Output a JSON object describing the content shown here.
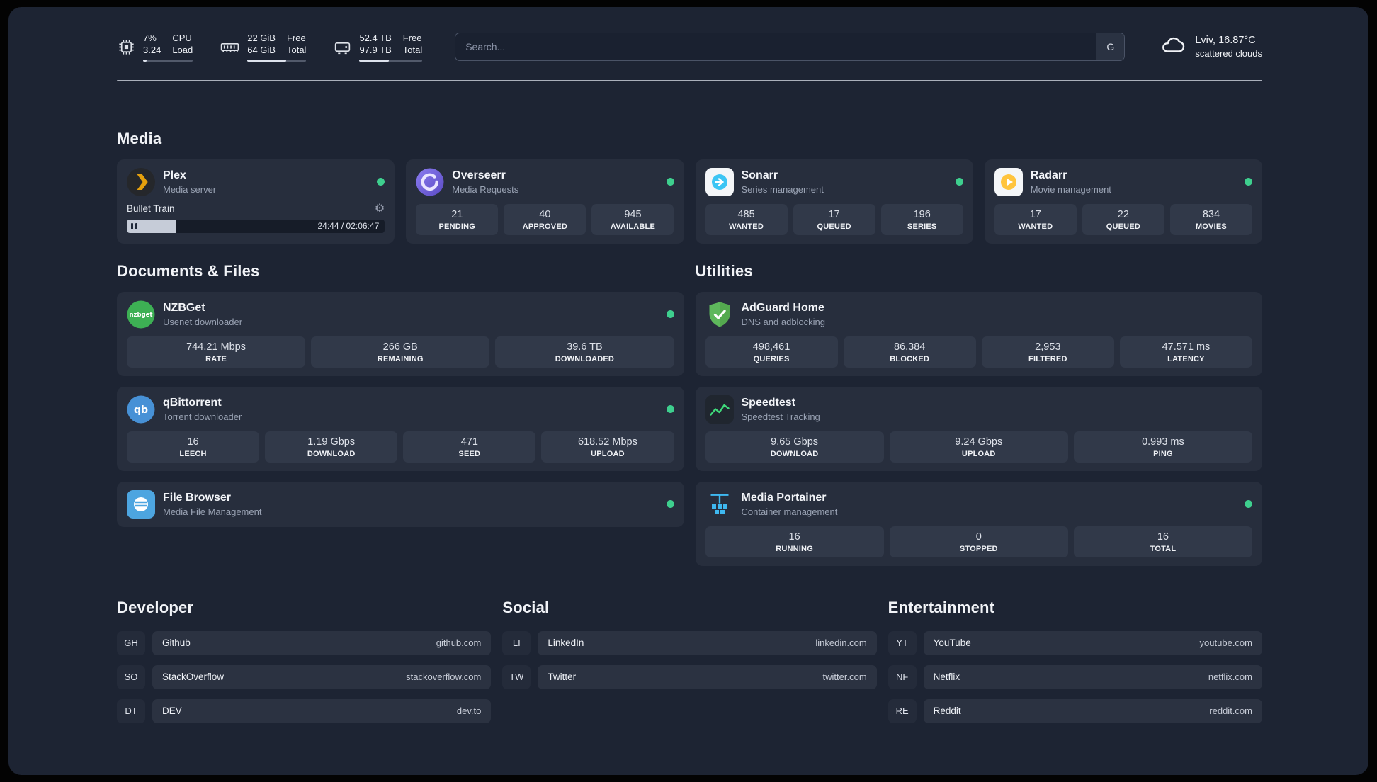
{
  "topbar": {
    "cpu": {
      "value_top": "7%",
      "value_bottom": "3.24",
      "label_top": "CPU",
      "label_bottom": "Load"
    },
    "ram": {
      "value_top": "22 GiB",
      "value_bottom": "64 GiB",
      "label_top": "Free",
      "label_bottom": "Total"
    },
    "disk": {
      "value_top": "52.4 TB",
      "value_bottom": "97.9 TB",
      "label_top": "Free",
      "label_bottom": "Total"
    },
    "search": {
      "placeholder": "Search...",
      "button": "G"
    },
    "weather": {
      "location": "Lviv, 16.87°C",
      "description": "scattered clouds"
    }
  },
  "headings": {
    "media": "Media",
    "documents": "Documents & Files",
    "utilities": "Utilities"
  },
  "plex": {
    "name": "Plex",
    "subtitle": "Media server",
    "now_playing": "Bullet Train",
    "time": "24:44 / 02:06:47",
    "gear_icon": "⚙"
  },
  "overseerr": {
    "name": "Overseerr",
    "subtitle": "Media Requests",
    "stats": [
      {
        "value": "21",
        "label": "PENDING"
      },
      {
        "value": "40",
        "label": "APPROVED"
      },
      {
        "value": "945",
        "label": "AVAILABLE"
      }
    ]
  },
  "sonarr": {
    "name": "Sonarr",
    "subtitle": "Series management",
    "stats": [
      {
        "value": "485",
        "label": "WANTED"
      },
      {
        "value": "17",
        "label": "QUEUED"
      },
      {
        "value": "196",
        "label": "SERIES"
      }
    ]
  },
  "radarr": {
    "name": "Radarr",
    "subtitle": "Movie management",
    "stats": [
      {
        "value": "17",
        "label": "WANTED"
      },
      {
        "value": "22",
        "label": "QUEUED"
      },
      {
        "value": "834",
        "label": "MOVIES"
      }
    ]
  },
  "nzbget": {
    "name": "NZBGet",
    "subtitle": "Usenet downloader",
    "icon_text": "nzbget",
    "stats": [
      {
        "value": "744.21 Mbps",
        "label": "RATE"
      },
      {
        "value": "266 GB",
        "label": "REMAINING"
      },
      {
        "value": "39.6 TB",
        "label": "DOWNLOADED"
      }
    ]
  },
  "qbittorrent": {
    "name": "qBittorrent",
    "subtitle": "Torrent downloader",
    "icon_text": "qb",
    "stats": [
      {
        "value": "16",
        "label": "LEECH"
      },
      {
        "value": "1.19 Gbps",
        "label": "DOWNLOAD"
      },
      {
        "value": "471",
        "label": "SEED"
      },
      {
        "value": "618.52 Mbps",
        "label": "UPLOAD"
      }
    ]
  },
  "filebrowser": {
    "name": "File Browser",
    "subtitle": "Media File Management"
  },
  "adguard": {
    "name": "AdGuard Home",
    "subtitle": "DNS and adblocking",
    "stats": [
      {
        "value": "498,461",
        "label": "QUERIES"
      },
      {
        "value": "86,384",
        "label": "BLOCKED"
      },
      {
        "value": "2,953",
        "label": "FILTERED"
      },
      {
        "value": "47.571 ms",
        "label": "LATENCY"
      }
    ]
  },
  "speedtest": {
    "name": "Speedtest",
    "subtitle": "Speedtest Tracking",
    "stats": [
      {
        "value": "9.65 Gbps",
        "label": "DOWNLOAD"
      },
      {
        "value": "9.24 Gbps",
        "label": "UPLOAD"
      },
      {
        "value": "0.993 ms",
        "label": "PING"
      }
    ]
  },
  "portainer": {
    "name": "Media Portainer",
    "subtitle": "Container management",
    "stats": [
      {
        "value": "16",
        "label": "RUNNING"
      },
      {
        "value": "0",
        "label": "STOPPED"
      },
      {
        "value": "16",
        "label": "TOTAL"
      }
    ]
  },
  "bookmarks": {
    "developer": {
      "title": "Developer",
      "items": [
        {
          "abbr": "GH",
          "name": "Github",
          "url": "github.com"
        },
        {
          "abbr": "SO",
          "name": "StackOverflow",
          "url": "stackoverflow.com"
        },
        {
          "abbr": "DT",
          "name": "DEV",
          "url": "dev.to"
        }
      ]
    },
    "social": {
      "title": "Social",
      "items": [
        {
          "abbr": "LI",
          "name": "LinkedIn",
          "url": "linkedin.com"
        },
        {
          "abbr": "TW",
          "name": "Twitter",
          "url": "twitter.com"
        }
      ]
    },
    "entertainment": {
      "title": "Entertainment",
      "items": [
        {
          "abbr": "YT",
          "name": "YouTube",
          "url": "youtube.com"
        },
        {
          "abbr": "NF",
          "name": "Netflix",
          "url": "netflix.com"
        },
        {
          "abbr": "RE",
          "name": "Reddit",
          "url": "reddit.com"
        }
      ]
    }
  },
  "colors": {
    "status_online": "#3ecf8e",
    "accent_plex": "#e5a00d",
    "accent_sonarr": "#3cc5f4",
    "accent_radarr": "#ffc43d",
    "accent_adguard": "#5eb85c",
    "accent_portainer": "#3eb8f0"
  }
}
